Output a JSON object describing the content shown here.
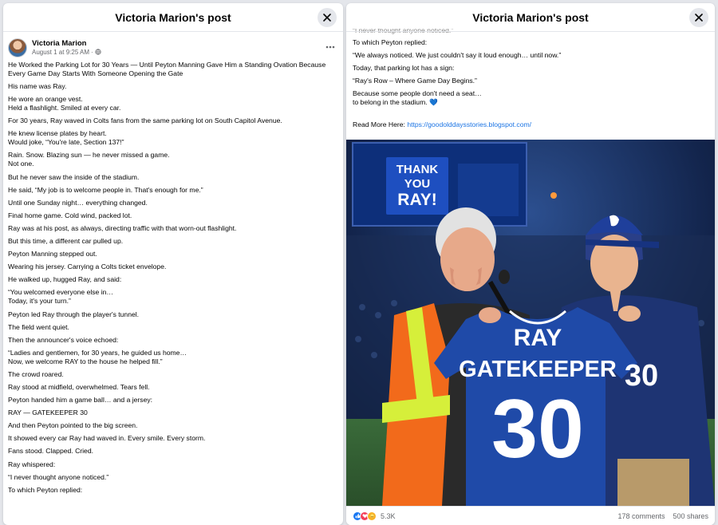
{
  "left_modal": {
    "title": "Victoria Marion's post",
    "author": "Victoria Marion",
    "timestamp": "August 1 at 9:25 AM",
    "meta_separator": "·",
    "audience_icon": "globe-icon",
    "paragraphs": [
      "He Worked the Parking Lot for 30 Years — Until Peyton Manning Gave Him a Standing Ovation Because Every Game Day Starts With Someone Opening the Gate",
      "His name was Ray.",
      "He wore an orange vest.\nHeld a flashlight. Smiled at every car.",
      "For 30 years, Ray waved in Colts fans from the same parking lot on South Capitol Avenue.",
      "He knew license plates by heart.\nWould joke, “You're late, Section 137!”",
      "Rain. Snow. Blazing sun — he never missed a game.\nNot one.",
      "But he never saw the inside of the stadium.",
      "He said, “My job is to welcome people in. That's enough for me.”",
      "Until one Sunday night… everything changed.",
      "Final home game. Cold wind, packed lot.",
      "Ray was at his post, as always, directing traffic with that worn-out flashlight.",
      "But this time, a different car pulled up.",
      "Peyton Manning stepped out.",
      "Wearing his jersey. Carrying a Colts ticket envelope.",
      "He walked up, hugged Ray, and said:",
      "“You welcomed everyone else in…\nToday, it's your turn.”",
      "Peyton led Ray through the player's tunnel.",
      "The field went quiet.",
      "Then the announcer's voice echoed:",
      "“Ladies and gentlemen, for 30 years, he guided us home…\nNow, we welcome RAY to the house he helped fill.”",
      "The crowd roared.",
      "Ray stood at midfield, overwhelmed. Tears fell.",
      "Peyton handed him a game ball… and a jersey:",
      "RAY — GATEKEEPER 30",
      "And then Peyton pointed to the big screen.",
      "It showed every car Ray had waved in. Every smile. Every storm.",
      "Fans stood. Clapped. Cried.",
      "Ray whispered:",
      "“I never thought anyone noticed.”",
      "To which Peyton replied:"
    ]
  },
  "right_modal": {
    "title": "Victoria Marion's post",
    "clipped_line": "“I never thought anyone noticed.”",
    "paragraphs": [
      "To which Peyton replied:",
      "“We always noticed. We just couldn't say it loud enough… until now.”",
      "Today, that parking lot has a sign:",
      "“Ray's Row – Where Game Day Begins.”",
      "Because some people don't need a seat…\nto belong in the stadium. 💙"
    ],
    "read_more_label": "Read More Here: ",
    "read_more_link": "https://goodolddaysstories.blogspot.com/",
    "photo": {
      "screen_text": [
        "THANK",
        "YOU",
        "RAY!"
      ],
      "jersey_name_1": "RAY",
      "jersey_name_2": "GATEKEEPER",
      "jersey_number": "30",
      "side_number": "30"
    },
    "reactions_icons": [
      "like-icon",
      "love-icon",
      "care-icon"
    ],
    "reaction_count": "5.3K",
    "comments": "178 comments",
    "shares": "500 shares"
  },
  "colors": {
    "link": "#1b74e4",
    "colts_blue": "#1f4aa8",
    "vest_orange": "#f26a1b",
    "page_bg": "#e4e6eb"
  }
}
